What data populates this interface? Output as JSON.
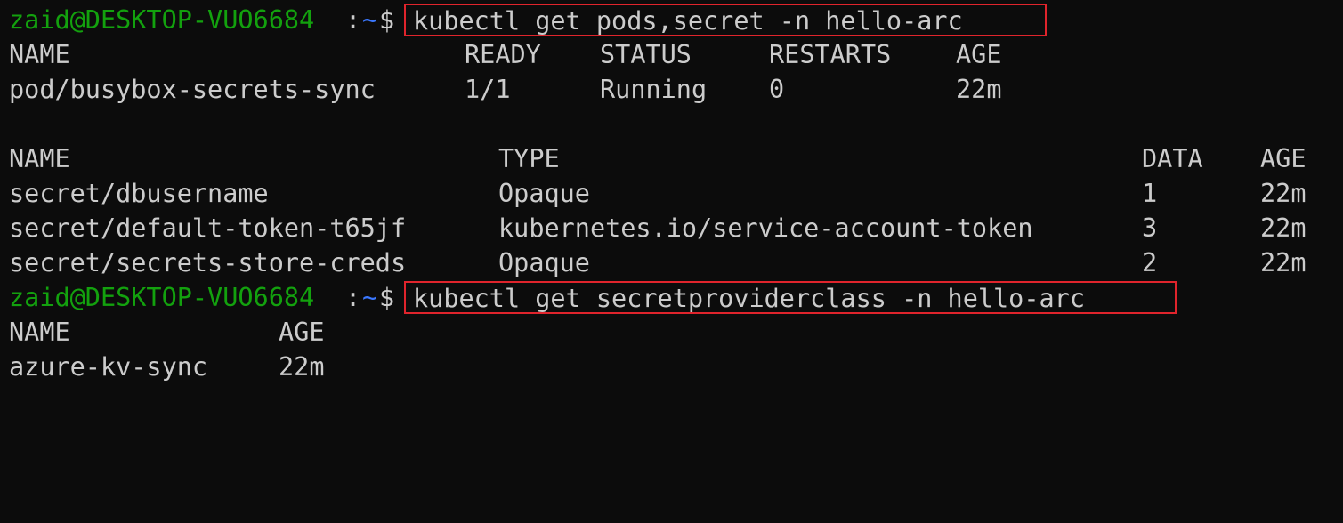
{
  "prompt": {
    "user_host": "zaid@DESKTOP-VUO6684",
    "colon": ":",
    "path": "~",
    "dollar": "$"
  },
  "commands": [
    "kubectl get pods,secret -n hello-arc",
    "kubectl get secretproviderclass -n hello-arc"
  ],
  "pods_table": {
    "headers": [
      "NAME",
      "READY",
      "STATUS",
      "RESTARTS",
      "AGE"
    ],
    "rows": [
      [
        "pod/busybox-secrets-sync",
        "1/1",
        "Running",
        "0",
        "22m"
      ]
    ]
  },
  "secrets_table": {
    "headers": [
      "NAME",
      "TYPE",
      "DATA",
      "AGE"
    ],
    "rows": [
      [
        "secret/dbusername",
        "Opaque",
        "1",
        "22m"
      ],
      [
        "secret/default-token-t65jf",
        "kubernetes.io/service-account-token",
        "3",
        "22m"
      ],
      [
        "secret/secrets-store-creds",
        "Opaque",
        "2",
        "22m"
      ]
    ]
  },
  "spc_table": {
    "headers": [
      "NAME",
      "AGE"
    ],
    "rows": [
      [
        "azure-kv-sync",
        "22m"
      ]
    ]
  },
  "colors": {
    "background": "#0c0c0c",
    "text": "#cccccc",
    "user_host": "#13a10e",
    "path": "#3b78ff",
    "highlight_box": "#e0242c"
  }
}
